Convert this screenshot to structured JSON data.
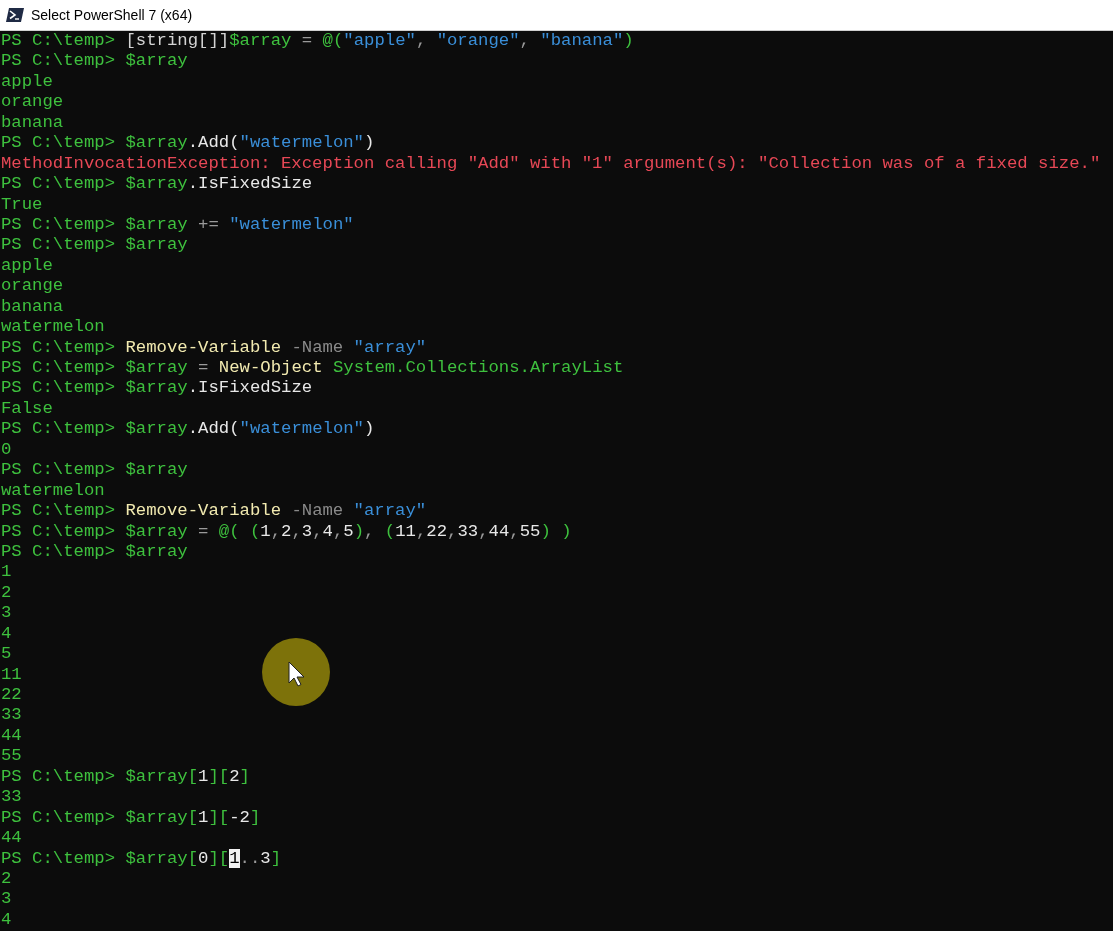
{
  "window": {
    "title": "Select PowerShell 7 (x64)"
  },
  "lines": [
    {
      "kind": "command",
      "prompt": "PS C:\\temp> ",
      "tokens": [
        {
          "kind": "type",
          "text": "[string[]]"
        },
        {
          "kind": "variable",
          "text": "$array"
        },
        {
          "kind": "operator",
          "text": " = "
        },
        {
          "kind": "group",
          "text": "@("
        },
        {
          "kind": "string",
          "text": "\"apple\""
        },
        {
          "kind": "operator",
          "text": ", "
        },
        {
          "kind": "string",
          "text": "\"orange\""
        },
        {
          "kind": "operator",
          "text": ", "
        },
        {
          "kind": "string",
          "text": "\"banana\""
        },
        {
          "kind": "group",
          "text": ")"
        }
      ]
    },
    {
      "kind": "command",
      "prompt": "PS C:\\temp> ",
      "tokens": [
        {
          "kind": "variable",
          "text": "$array"
        }
      ]
    },
    {
      "kind": "output",
      "text": "apple"
    },
    {
      "kind": "output",
      "text": "orange"
    },
    {
      "kind": "output",
      "text": "banana"
    },
    {
      "kind": "command",
      "prompt": "PS C:\\temp> ",
      "tokens": [
        {
          "kind": "variable",
          "text": "$array"
        },
        {
          "kind": "member",
          "text": ".Add("
        },
        {
          "kind": "string",
          "text": "\"watermelon\""
        },
        {
          "kind": "member",
          "text": ")"
        }
      ]
    },
    {
      "kind": "error",
      "text": "MethodInvocationException: Exception calling \"Add\" with \"1\" argument(s): \"Collection was of a fixed size.\""
    },
    {
      "kind": "command",
      "prompt": "PS C:\\temp> ",
      "tokens": [
        {
          "kind": "variable",
          "text": "$array"
        },
        {
          "kind": "member",
          "text": ".IsFixedSize"
        }
      ]
    },
    {
      "kind": "output",
      "text": "True"
    },
    {
      "kind": "command",
      "prompt": "PS C:\\temp> ",
      "tokens": [
        {
          "kind": "variable",
          "text": "$array"
        },
        {
          "kind": "operator",
          "text": " += "
        },
        {
          "kind": "string",
          "text": "\"watermelon\""
        }
      ]
    },
    {
      "kind": "command",
      "prompt": "PS C:\\temp> ",
      "tokens": [
        {
          "kind": "variable",
          "text": "$array"
        }
      ]
    },
    {
      "kind": "output",
      "text": "apple"
    },
    {
      "kind": "output",
      "text": "orange"
    },
    {
      "kind": "output",
      "text": "banana"
    },
    {
      "kind": "output",
      "text": "watermelon"
    },
    {
      "kind": "command",
      "prompt": "PS C:\\temp> ",
      "tokens": [
        {
          "kind": "cmdlet",
          "text": "Remove-Variable"
        },
        {
          "kind": "parameter",
          "text": " -Name "
        },
        {
          "kind": "string",
          "text": "\"array\""
        }
      ]
    },
    {
      "kind": "command",
      "prompt": "PS C:\\temp> ",
      "tokens": [
        {
          "kind": "variable",
          "text": "$array"
        },
        {
          "kind": "operator",
          "text": " = "
        },
        {
          "kind": "cmdlet",
          "text": "New-Object"
        },
        {
          "kind": "group",
          "text": " System.Collections.ArrayList"
        }
      ]
    },
    {
      "kind": "command",
      "prompt": "PS C:\\temp> ",
      "tokens": [
        {
          "kind": "variable",
          "text": "$array"
        },
        {
          "kind": "member",
          "text": ".IsFixedSize"
        }
      ]
    },
    {
      "kind": "output",
      "text": "False"
    },
    {
      "kind": "command",
      "prompt": "PS C:\\temp> ",
      "tokens": [
        {
          "kind": "variable",
          "text": "$array"
        },
        {
          "kind": "member",
          "text": ".Add("
        },
        {
          "kind": "string",
          "text": "\"watermelon\""
        },
        {
          "kind": "member",
          "text": ")"
        }
      ]
    },
    {
      "kind": "output",
      "text": "0"
    },
    {
      "kind": "command",
      "prompt": "PS C:\\temp> ",
      "tokens": [
        {
          "kind": "variable",
          "text": "$array"
        }
      ]
    },
    {
      "kind": "output",
      "text": "watermelon"
    },
    {
      "kind": "command",
      "prompt": "PS C:\\temp> ",
      "tokens": [
        {
          "kind": "cmdlet",
          "text": "Remove-Variable"
        },
        {
          "kind": "parameter",
          "text": " -Name "
        },
        {
          "kind": "string",
          "text": "\"array\""
        }
      ]
    },
    {
      "kind": "command",
      "prompt": "PS C:\\temp> ",
      "tokens": [
        {
          "kind": "variable",
          "text": "$array"
        },
        {
          "kind": "operator",
          "text": " = "
        },
        {
          "kind": "group",
          "text": "@( ("
        },
        {
          "kind": "number",
          "text": "1"
        },
        {
          "kind": "operator",
          "text": ","
        },
        {
          "kind": "number",
          "text": "2"
        },
        {
          "kind": "operator",
          "text": ","
        },
        {
          "kind": "number",
          "text": "3"
        },
        {
          "kind": "operator",
          "text": ","
        },
        {
          "kind": "number",
          "text": "4"
        },
        {
          "kind": "operator",
          "text": ","
        },
        {
          "kind": "number",
          "text": "5"
        },
        {
          "kind": "group",
          "text": ")"
        },
        {
          "kind": "operator",
          "text": ", "
        },
        {
          "kind": "group",
          "text": "("
        },
        {
          "kind": "number",
          "text": "11"
        },
        {
          "kind": "operator",
          "text": ","
        },
        {
          "kind": "number",
          "text": "22"
        },
        {
          "kind": "operator",
          "text": ","
        },
        {
          "kind": "number",
          "text": "33"
        },
        {
          "kind": "operator",
          "text": ","
        },
        {
          "kind": "number",
          "text": "44"
        },
        {
          "kind": "operator",
          "text": ","
        },
        {
          "kind": "number",
          "text": "55"
        },
        {
          "kind": "group",
          "text": ") )"
        }
      ]
    },
    {
      "kind": "command",
      "prompt": "PS C:\\temp> ",
      "tokens": [
        {
          "kind": "variable",
          "text": "$array"
        }
      ]
    },
    {
      "kind": "output",
      "text": "1"
    },
    {
      "kind": "output",
      "text": "2"
    },
    {
      "kind": "output",
      "text": "3"
    },
    {
      "kind": "output",
      "text": "4"
    },
    {
      "kind": "output",
      "text": "5"
    },
    {
      "kind": "output",
      "text": "11"
    },
    {
      "kind": "output",
      "text": "22"
    },
    {
      "kind": "output",
      "text": "33"
    },
    {
      "kind": "output",
      "text": "44"
    },
    {
      "kind": "output",
      "text": "55"
    },
    {
      "kind": "command",
      "prompt": "PS C:\\temp> ",
      "tokens": [
        {
          "kind": "variable",
          "text": "$array"
        },
        {
          "kind": "group",
          "text": "["
        },
        {
          "kind": "number",
          "text": "1"
        },
        {
          "kind": "group",
          "text": "]["
        },
        {
          "kind": "number",
          "text": "2"
        },
        {
          "kind": "group",
          "text": "]"
        }
      ]
    },
    {
      "kind": "output",
      "text": "33"
    },
    {
      "kind": "command",
      "prompt": "PS C:\\temp> ",
      "tokens": [
        {
          "kind": "variable",
          "text": "$array"
        },
        {
          "kind": "group",
          "text": "["
        },
        {
          "kind": "number",
          "text": "1"
        },
        {
          "kind": "group",
          "text": "]["
        },
        {
          "kind": "number",
          "text": "-2"
        },
        {
          "kind": "group",
          "text": "]"
        }
      ]
    },
    {
      "kind": "output",
      "text": "44"
    },
    {
      "kind": "command",
      "prompt": "PS C:\\temp> ",
      "tokens": [
        {
          "kind": "variable",
          "text": "$array"
        },
        {
          "kind": "group",
          "text": "["
        },
        {
          "kind": "number",
          "text": "0"
        },
        {
          "kind": "group",
          "text": "]["
        },
        {
          "kind": "cursor",
          "text": "1"
        },
        {
          "kind": "operator",
          "text": ".."
        },
        {
          "kind": "number",
          "text": "3"
        },
        {
          "kind": "group",
          "text": "]"
        }
      ]
    },
    {
      "kind": "output",
      "text": "2"
    },
    {
      "kind": "output",
      "text": "3"
    },
    {
      "kind": "output",
      "text": "4"
    }
  ]
}
